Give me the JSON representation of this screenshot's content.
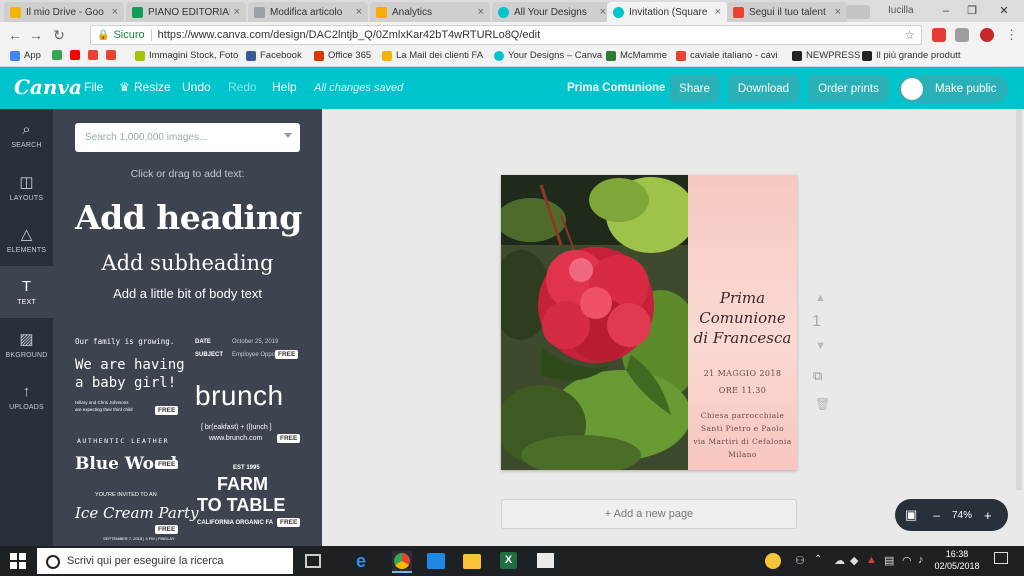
{
  "browser": {
    "tabs": [
      {
        "title": "Il mio Drive - Goo",
        "color": "#f4b400"
      },
      {
        "title": "PIANO EDITORIAL",
        "color": "#0f9d58"
      },
      {
        "title": "Modifica articolo",
        "color": "#9aa0a6"
      },
      {
        "title": "Analytics",
        "color": "#f9ab00"
      },
      {
        "title": "All Your Designs",
        "color": "#00c4cc"
      },
      {
        "title": "Invitation (Square",
        "color": "#00c4cc"
      },
      {
        "title": "Segui il tuo talent",
        "color": "#ea4335"
      }
    ],
    "close_glyph": "×",
    "profile": "Iucilla",
    "window_controls": [
      "–",
      "❐",
      "✕"
    ],
    "secure_label": "Sicuro",
    "url": "https://www.canva.com/design/DAC2lntjb_Q/0ZmlxKar42bT4wRTURLo8Q/edit",
    "bookmarks": [
      {
        "label": "App",
        "color": "#4285f4"
      },
      {
        "label": "",
        "color": "#34a853"
      },
      {
        "label": "",
        "color": "#ff0000"
      },
      {
        "label": "",
        "color": "#ea4335"
      },
      {
        "label": "",
        "color": "#ea4335"
      },
      {
        "label": "Immagini Stock, Foto",
        "color": "#a4c400"
      },
      {
        "label": "Facebook",
        "color": "#3b5998"
      },
      {
        "label": "Office 365",
        "color": "#d83b01"
      },
      {
        "label": "La Mail dei clienti FA",
        "color": "#f4b400"
      },
      {
        "label": "Your Designs – Canva",
        "color": "#00c4cc"
      },
      {
        "label": "McMamme",
        "color": "#2e7d32"
      },
      {
        "label": "caviale italiano - cavi",
        "color": "#ea4335"
      },
      {
        "label": "NEWPRESS",
        "color": "#222222"
      },
      {
        "label": "Il più grande produtt",
        "color": "#222222"
      }
    ]
  },
  "canva": {
    "logo": "Canva",
    "menu": [
      "File",
      "Resize",
      "Undo",
      "Redo",
      "Help"
    ],
    "saved_status": "All changes saved",
    "document_title": "Prima Comunione",
    "buttons": {
      "share": "Share",
      "download": "Download",
      "order_prints": "Order prints",
      "make_public": "Make public"
    },
    "accent": "#00c4cc"
  },
  "rail": [
    {
      "label": "SEARCH",
      "icon": "search-icon",
      "glyph": "⌕"
    },
    {
      "label": "LAYOUTS",
      "icon": "layouts-icon",
      "glyph": "◫"
    },
    {
      "label": "ELEMENTS",
      "icon": "elements-icon",
      "glyph": "△"
    },
    {
      "label": "TEXT",
      "icon": "text-icon",
      "glyph": "T",
      "active": true
    },
    {
      "label": "BKGROUND",
      "icon": "background-icon",
      "glyph": "▨"
    },
    {
      "label": "UPLOADS",
      "icon": "upload-icon",
      "glyph": "↑"
    }
  ],
  "panel": {
    "search_placeholder": "Search 1,000,000 images...",
    "click_drag": "Click or drag to add text:",
    "add_heading": "Add heading",
    "add_subheading": "Add subheading",
    "add_body": "Add a little bit of body text",
    "free_badge": "FREE",
    "templates": {
      "baby": {
        "l1": "Our family is growing.",
        "l2": "We are having",
        "l3": "a baby girl!",
        "l4": "Hillary and Chris Johnsons",
        "l5": "are expecting their third child"
      },
      "date": {
        "label1": "DATE",
        "value1": "October 25, 2019",
        "label2": "SUBJECT",
        "value2": "Employee Opport..."
      },
      "brunch": {
        "title": "brunch",
        "sub": "[ br(eakfast) + (l)unch ]",
        "url": "www.brunch.com"
      },
      "leather": {
        "top": "AUTHENTIC LEATHER",
        "main": "Blue Wood"
      },
      "farm": {
        "est": "EST 1995",
        "l1": "FARM",
        "l2": "TO TABLE",
        "l3": "CALIFORNIA ORGANIC FA"
      },
      "icecream": {
        "top": "YOU'RE INVITED TO AN",
        "main": "Ice Cream Party",
        "bottom": "SEPTEMBER 7, 2018 | 3 PM | FINDLAY"
      }
    }
  },
  "design": {
    "title_lines": [
      "Prima",
      "Comunione",
      "di Francesca"
    ],
    "date": "21 MAGGIO 2018",
    "time": "ORE 11.30",
    "place_lines": [
      "Chiesa parrocchiale",
      "Santi Pietro e Paolo",
      "via Martiri di Cefalonia",
      "Milano"
    ]
  },
  "workspace": {
    "page_number": "1",
    "add_page": "+ Add a new page",
    "zoom": "74%",
    "zoom_minus": "–",
    "zoom_plus": "+"
  },
  "taskbar": {
    "search_placeholder": "Scrivi qui per eseguire la ricerca",
    "time": "16:38",
    "date": "02/05/2018"
  }
}
